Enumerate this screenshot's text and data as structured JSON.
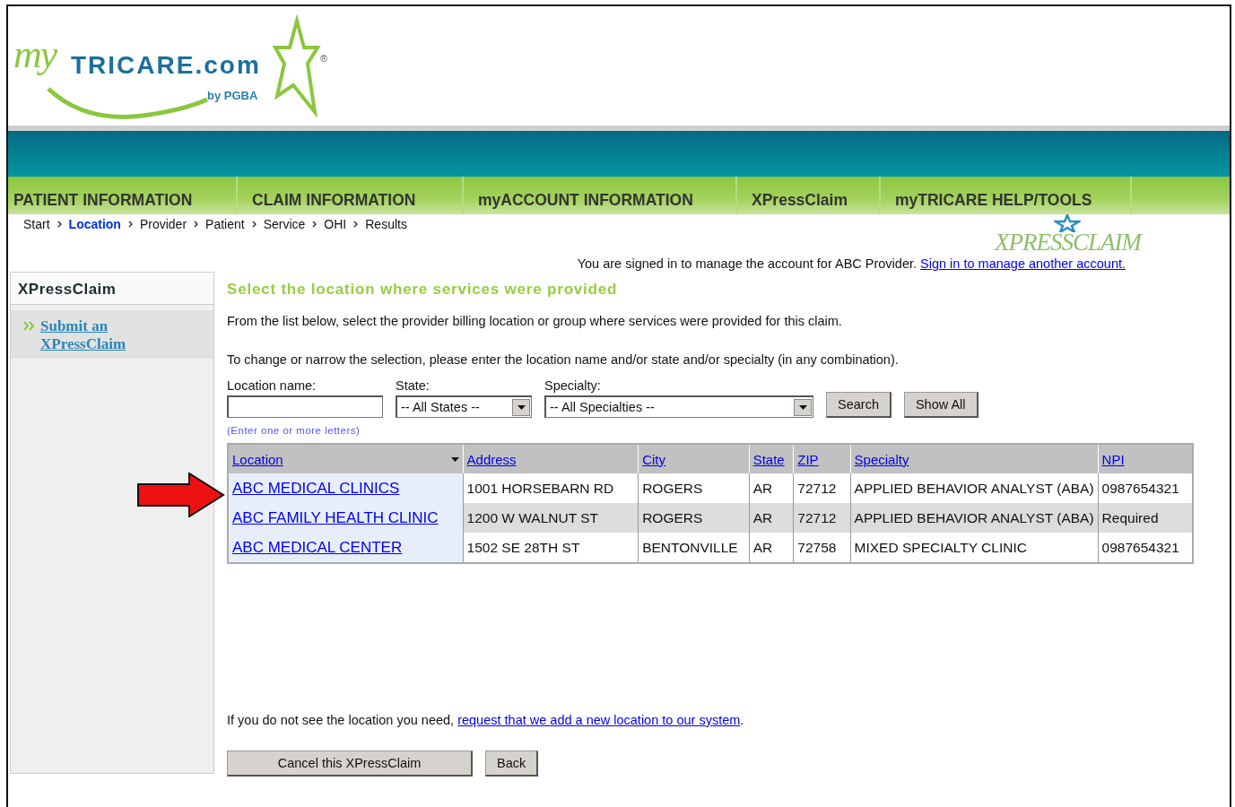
{
  "logo": {
    "script": "my",
    "name": "TRICARE.com",
    "mark": "®",
    "by": "by PGBA"
  },
  "nav": [
    {
      "label": "PATIENT INFORMATION"
    },
    {
      "label": "CLAIM INFORMATION"
    },
    {
      "label": "myACCOUNT INFORMATION"
    },
    {
      "label": "XPressClaim"
    },
    {
      "label": "myTRICARE HELP/TOOLS"
    }
  ],
  "breadcrumbs": [
    {
      "label": "Start",
      "selected": false
    },
    {
      "label": "Location",
      "selected": true
    },
    {
      "label": "Provider",
      "selected": false
    },
    {
      "label": "Patient",
      "selected": false
    },
    {
      "label": "Service",
      "selected": false
    },
    {
      "label": "OHI",
      "selected": false
    },
    {
      "label": "Results",
      "selected": false
    }
  ],
  "product_logo": "XPRESSCLAIM",
  "signed_in": {
    "text": "You are signed in to manage the account for ABC Provider.",
    "link": "Sign in to manage another account."
  },
  "sidebar": {
    "title": "XPressClaim",
    "items": [
      {
        "label": "Submit an XPressClaim"
      }
    ]
  },
  "heading": "Select the location where services were provided",
  "intro": "From the list below, select the provider billing location or group where services were provided for this claim.",
  "instruction": "To change or narrow the selection, please enter the location name and/or state and/or specialty (in any combination).",
  "filters": {
    "location_label": "Location name:",
    "location_hint": "(Enter one or more letters)",
    "state_label": "State:",
    "state_value": "-- All States --",
    "specialty_label": "Specialty:",
    "specialty_value": "-- All Specialties --",
    "buttons": [
      "Search",
      "Show All"
    ]
  },
  "table": {
    "columns": [
      {
        "label": "Location",
        "sorted": true
      },
      {
        "label": "Address",
        "sorted": false
      },
      {
        "label": "City",
        "sorted": false
      },
      {
        "label": "State",
        "sorted": false
      },
      {
        "label": "ZIP",
        "sorted": false
      },
      {
        "label": "Specialty",
        "sorted": false
      },
      {
        "label": "NPI",
        "sorted": false
      }
    ],
    "rows": [
      {
        "pointed": true,
        "cells": [
          "ABC MEDICAL CLINICS",
          "1001 HORSEBARN RD",
          "ROGERS",
          "AR",
          "72712",
          "APPLIED BEHAVIOR ANALYST (ABA)",
          "0987654321"
        ]
      },
      {
        "pointed": false,
        "cells": [
          "ABC FAMILY HEALTH CLINIC",
          "1200 W WALNUT ST",
          "ROGERS",
          "AR",
          "72712",
          "APPLIED BEHAVIOR ANALYST (ABA)",
          "Required"
        ]
      },
      {
        "pointed": false,
        "cells": [
          "ABC MEDICAL CENTER",
          "1502 SE 28TH ST",
          "BENTONVILLE",
          "AR",
          "72758",
          "MIXED SPECIALTY CLINIC",
          "0987654321"
        ]
      }
    ]
  },
  "footer_note": {
    "text": "If you do not see the location you need,",
    "link": "request that we add a new location to our system",
    "end": "."
  },
  "buttons": [
    "Cancel this XPressClaim",
    "Back"
  ]
}
